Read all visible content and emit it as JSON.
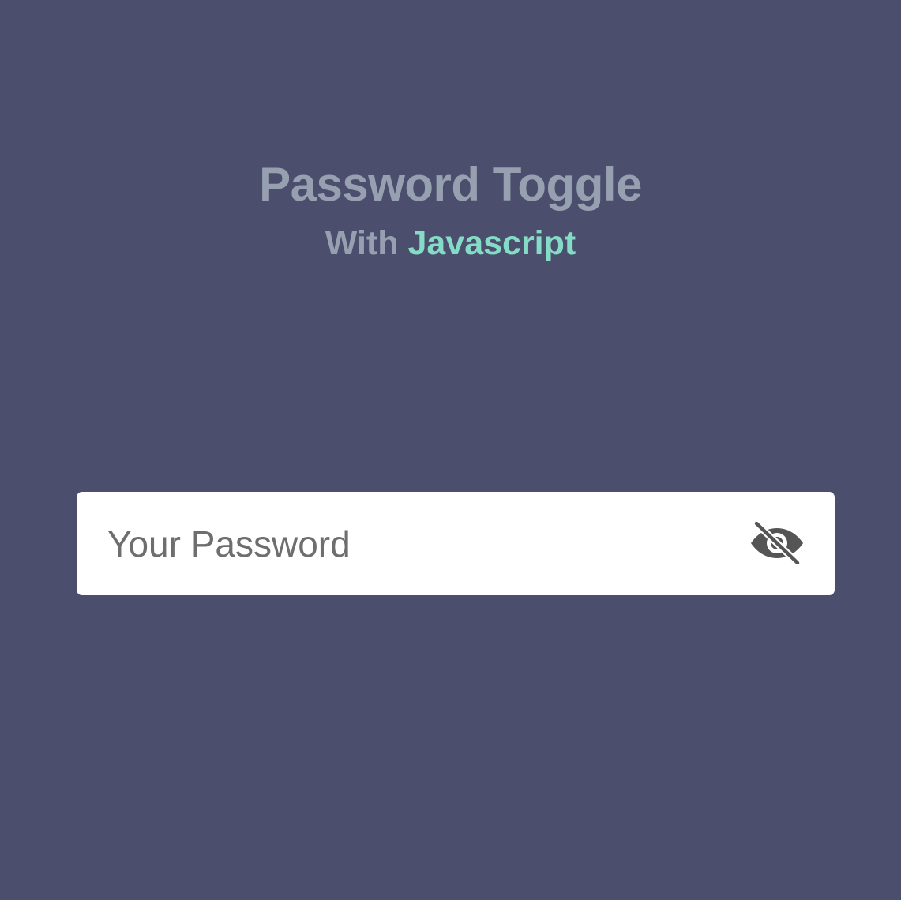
{
  "header": {
    "title": "Password Toggle",
    "subtitle_prefix": "With ",
    "subtitle_accent": "Javascript"
  },
  "password_field": {
    "value": "",
    "placeholder": "Your Password",
    "toggle_icon": "eye-slash-icon"
  },
  "colors": {
    "background": "#4b4e6d",
    "title": "#97a0b0",
    "accent": "#84dcc6",
    "field_background": "#ffffff",
    "placeholder": "#6e6e6e",
    "icon": "#555555"
  }
}
